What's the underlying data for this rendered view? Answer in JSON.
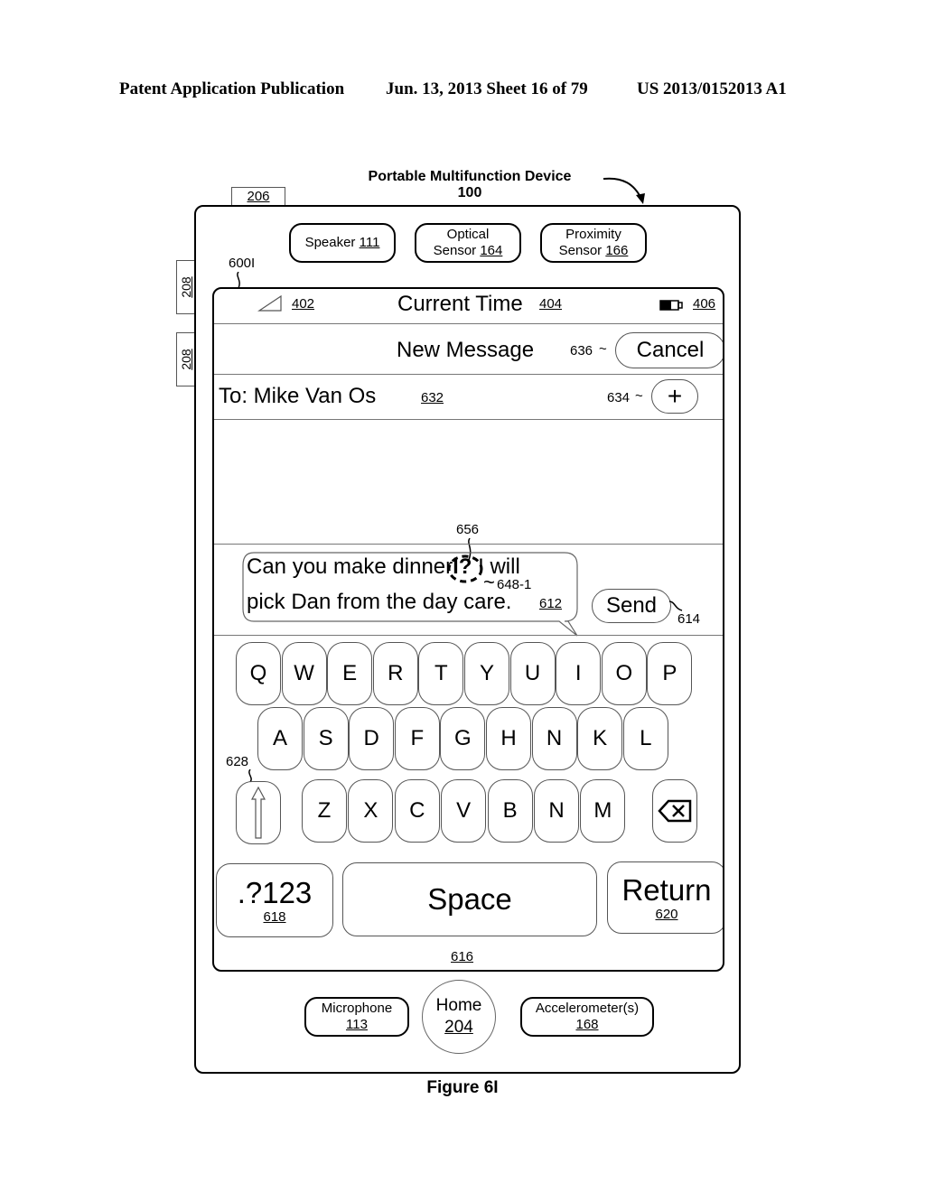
{
  "header": {
    "publication": "Patent Application Publication",
    "date_sheet": "Jun. 13, 2013  Sheet 16 of 79",
    "patent_number": "US 2013/0152013 A1"
  },
  "device": {
    "title": "Portable Multifunction Device",
    "ref": "100",
    "tab_ref": "206",
    "side_button_refs": [
      "208",
      "208"
    ],
    "screen_ref": "600I",
    "top_components": [
      {
        "label": "Speaker",
        "ref": "111"
      },
      {
        "label": "Optical",
        "label2": "Sensor",
        "ref": "164"
      },
      {
        "label": "Proximity",
        "label2": "Sensor",
        "ref": "166"
      }
    ],
    "bottom_components": [
      {
        "label": "Microphone",
        "ref": "113"
      },
      {
        "label": "Home",
        "ref": "204"
      },
      {
        "label": "Accelerometer(s)",
        "ref": "168"
      }
    ]
  },
  "status_bar": {
    "signal_ref": "402",
    "time_label": "Current Time",
    "time_ref": "404",
    "battery_ref": "406"
  },
  "nav_bar": {
    "title": "New Message",
    "cancel_label": "Cancel",
    "cancel_ref": "636"
  },
  "to_field": {
    "value": "To: Mike Van Os",
    "ref": "632",
    "add_button": "+",
    "add_ref": "634"
  },
  "compose": {
    "insertion_ref": "656",
    "line1_before": "Can you make dinn",
    "line1_highlight": "er",
    "line1_cursor": "l?",
    "line1_after": " I will",
    "highlight_ref": "648-1",
    "line2": "pick Dan from the day care.",
    "bubble_ref": "612",
    "send_label": "Send",
    "send_ref": "614"
  },
  "keyboard": {
    "row1": [
      "Q",
      "W",
      "E",
      "R",
      "T",
      "Y",
      "U",
      "I",
      "O",
      "P"
    ],
    "row2": [
      "A",
      "S",
      "D",
      "F",
      "G",
      "H",
      "N",
      "K",
      "L"
    ],
    "row3": [
      "Z",
      "X",
      "C",
      "V",
      "B",
      "N",
      "M"
    ],
    "shift_ref": "628",
    "numbers_label": ".?123",
    "numbers_ref": "618",
    "space_label": "Space",
    "return_label": "Return",
    "return_ref": "620",
    "keyboard_ref": "616"
  },
  "figure_caption": "Figure 6I"
}
